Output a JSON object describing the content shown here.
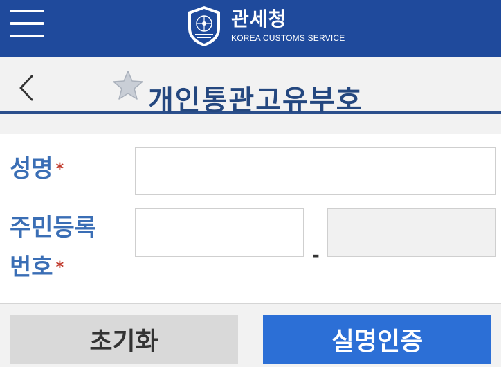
{
  "header": {
    "agency_name": "관세청",
    "agency_name_en": "KOREA CUSTOMS SERVICE"
  },
  "page": {
    "title": "개인통관고유부호"
  },
  "form": {
    "name_label": "성명",
    "rrn_label_line1": "주민등록",
    "rrn_label_line2": "번호",
    "required_mark": "*",
    "dash": "-",
    "name_value": "",
    "rrn_front_value": "",
    "rrn_back_value": ""
  },
  "buttons": {
    "reset_label": "초기화",
    "verify_label": "실명인증"
  },
  "colors": {
    "header_bg": "#1f4a9c",
    "title_text": "#24477f",
    "label_text": "#3a6eb5",
    "required_mark": "#c0392b",
    "reset_bg": "#d9d9d9",
    "verify_bg": "#2c6fd6"
  },
  "icons": {
    "menu": "hamburger-menu-icon",
    "emblem": "customs-emblem-icon",
    "back": "chevron-left-icon",
    "favorite": "star-icon"
  }
}
